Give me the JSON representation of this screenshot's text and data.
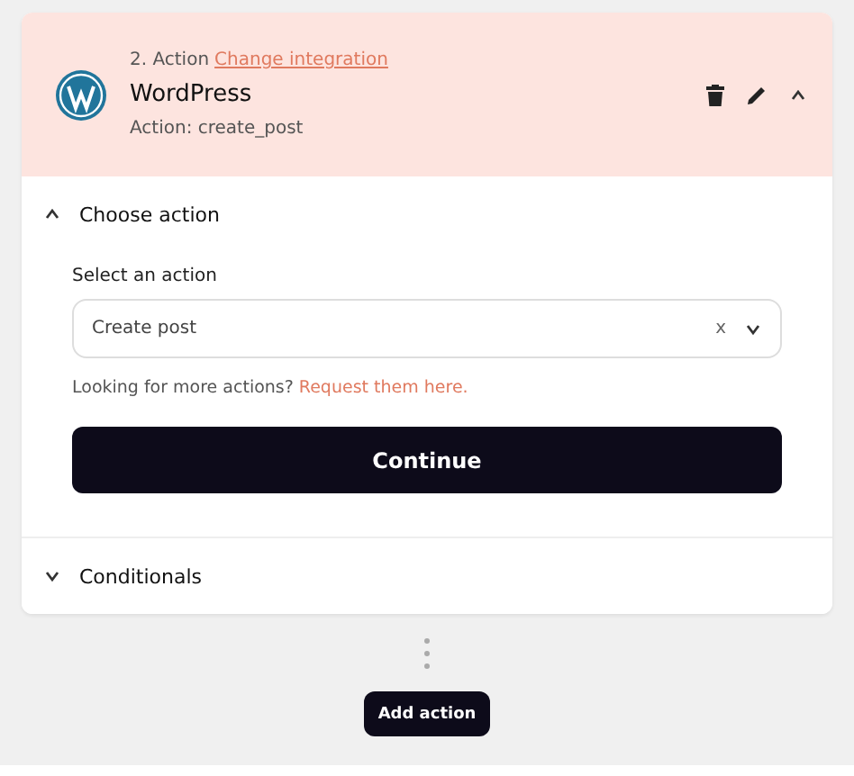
{
  "step": {
    "label": "2. Action",
    "link": "Change integration",
    "app_name": "WordPress",
    "action": "Action: create_post"
  },
  "sections": [
    {
      "title": "Choose action",
      "expanded": true,
      "field": {
        "label": "Select an action",
        "value": "Create post",
        "clear": "x"
      },
      "help": {
        "text": "Looking for more actions?",
        "link": "Request them here."
      },
      "button": "Continue"
    },
    {
      "title": "Conditionals",
      "expanded": false
    }
  ],
  "add_button": "Add action"
}
